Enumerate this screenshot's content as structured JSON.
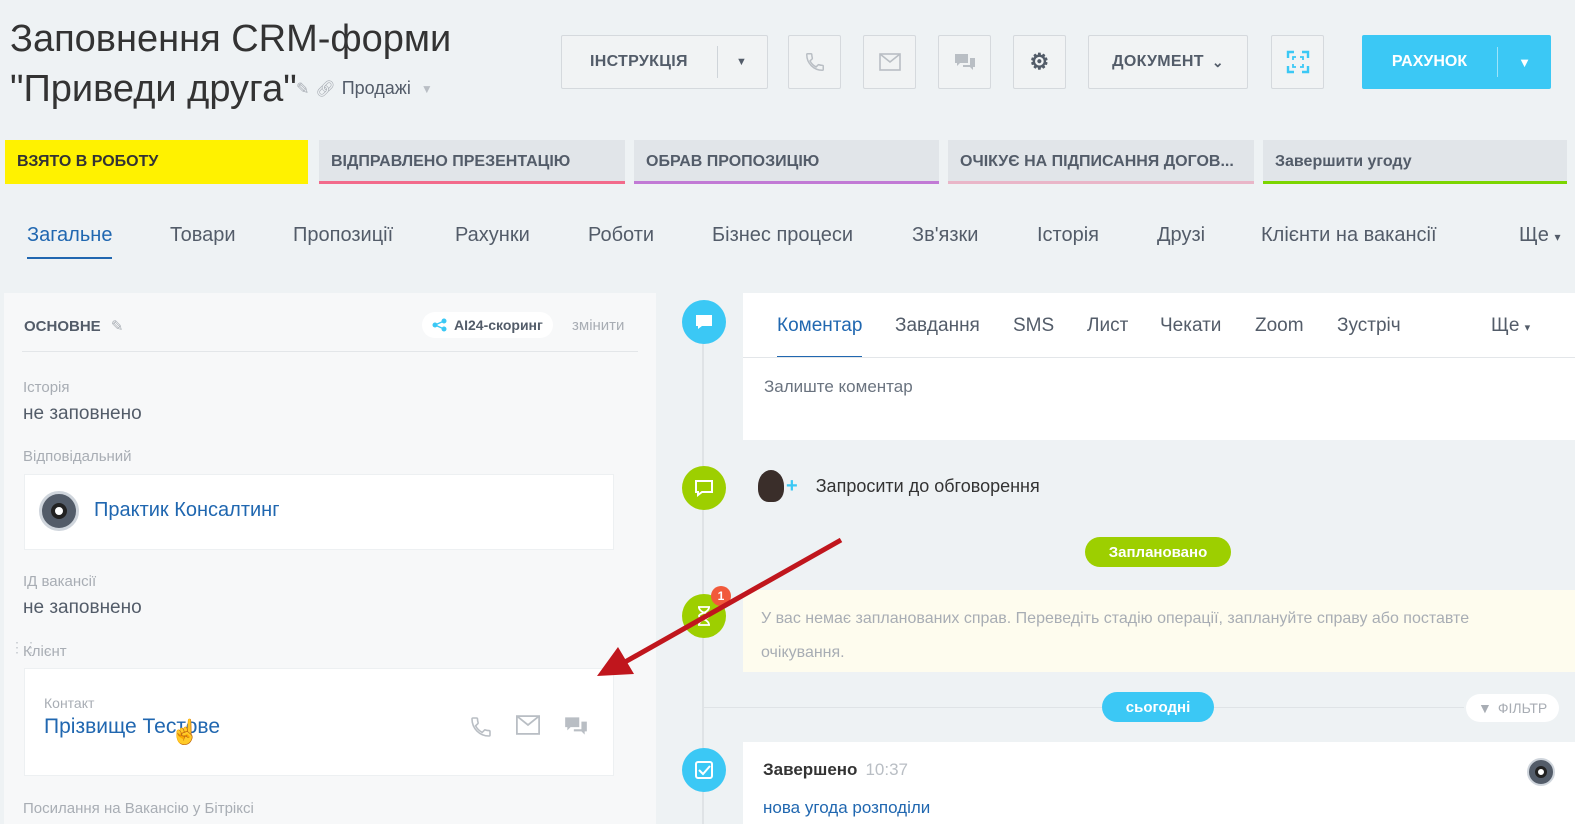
{
  "header": {
    "title_line1": "Заповнення CRM-форми",
    "title_line2": "\"Приведи  друга\"",
    "category": "Продажі",
    "instruction_label": "ІНСТРУКЦІЯ",
    "document_label": "ДОКУМЕНТ",
    "account_label": "РАХУНОК"
  },
  "stages": [
    {
      "label": "ВЗЯТО В РОБОТУ",
      "color": "#fff200"
    },
    {
      "label": "ВІДПРАВЛЕНО ПРЕЗЕНТАЦІЮ",
      "color": "#f26b8b"
    },
    {
      "label": "ОБРАВ ПРОПОЗИЦІЮ",
      "color": "#c17ad5"
    },
    {
      "label": "ОЧІКУЄ НА ПІДПИСАННЯ ДОГОВ...",
      "color": "#e9b6c8"
    },
    {
      "label": "Завершити угоду",
      "color": "#7bd500"
    }
  ],
  "tabs": [
    "Загальне",
    "Товари",
    "Пропозиції",
    "Рахунки",
    "Роботи",
    "Бізнес процеси",
    "Зв'язки",
    "Історія",
    "Друзі",
    "Клієнти на вакансії",
    "Ще"
  ],
  "left": {
    "section_title": "ОСНОВНЕ",
    "ai_label": "AI24-скоринг",
    "change_label": "змінити",
    "history_label": "Історія",
    "history_value": "не заповнено",
    "responsible_label": "Відповідальний",
    "responsible_name": "Практик Консалтинг",
    "vacancy_label": "ІД вакансії",
    "vacancy_value": "не заповнено",
    "client_label": "Клієнт",
    "contact_label": "Контакт",
    "contact_name": "Прізвище Тестове",
    "link_label": "Посилання на Вакансію у Бітріксі"
  },
  "comment": {
    "tabs": [
      "Коментар",
      "Завдання",
      "SMS",
      "Лист",
      "Чекати",
      "Zoom",
      "Зустріч",
      "Ще"
    ],
    "placeholder": "Залиште коментар"
  },
  "timeline": {
    "invite_label": "Запросити до обговорення",
    "planned_label": "Заплановано",
    "badge_count": "1",
    "empty_text": "У вас немає запланованих справ. Переведіть стадію операції, заплануйте справу або поставте очікування.",
    "today_label": "сьогодні",
    "filter_label": "ФІЛЬТР",
    "done_title": "Завершено",
    "done_time": "10:37",
    "done_link": "нова угода розподіли"
  },
  "colors": {
    "accent": "#3bc8f5",
    "link": "#2067b0",
    "planned": "#9dcf00",
    "arrow": "#c0161d"
  }
}
